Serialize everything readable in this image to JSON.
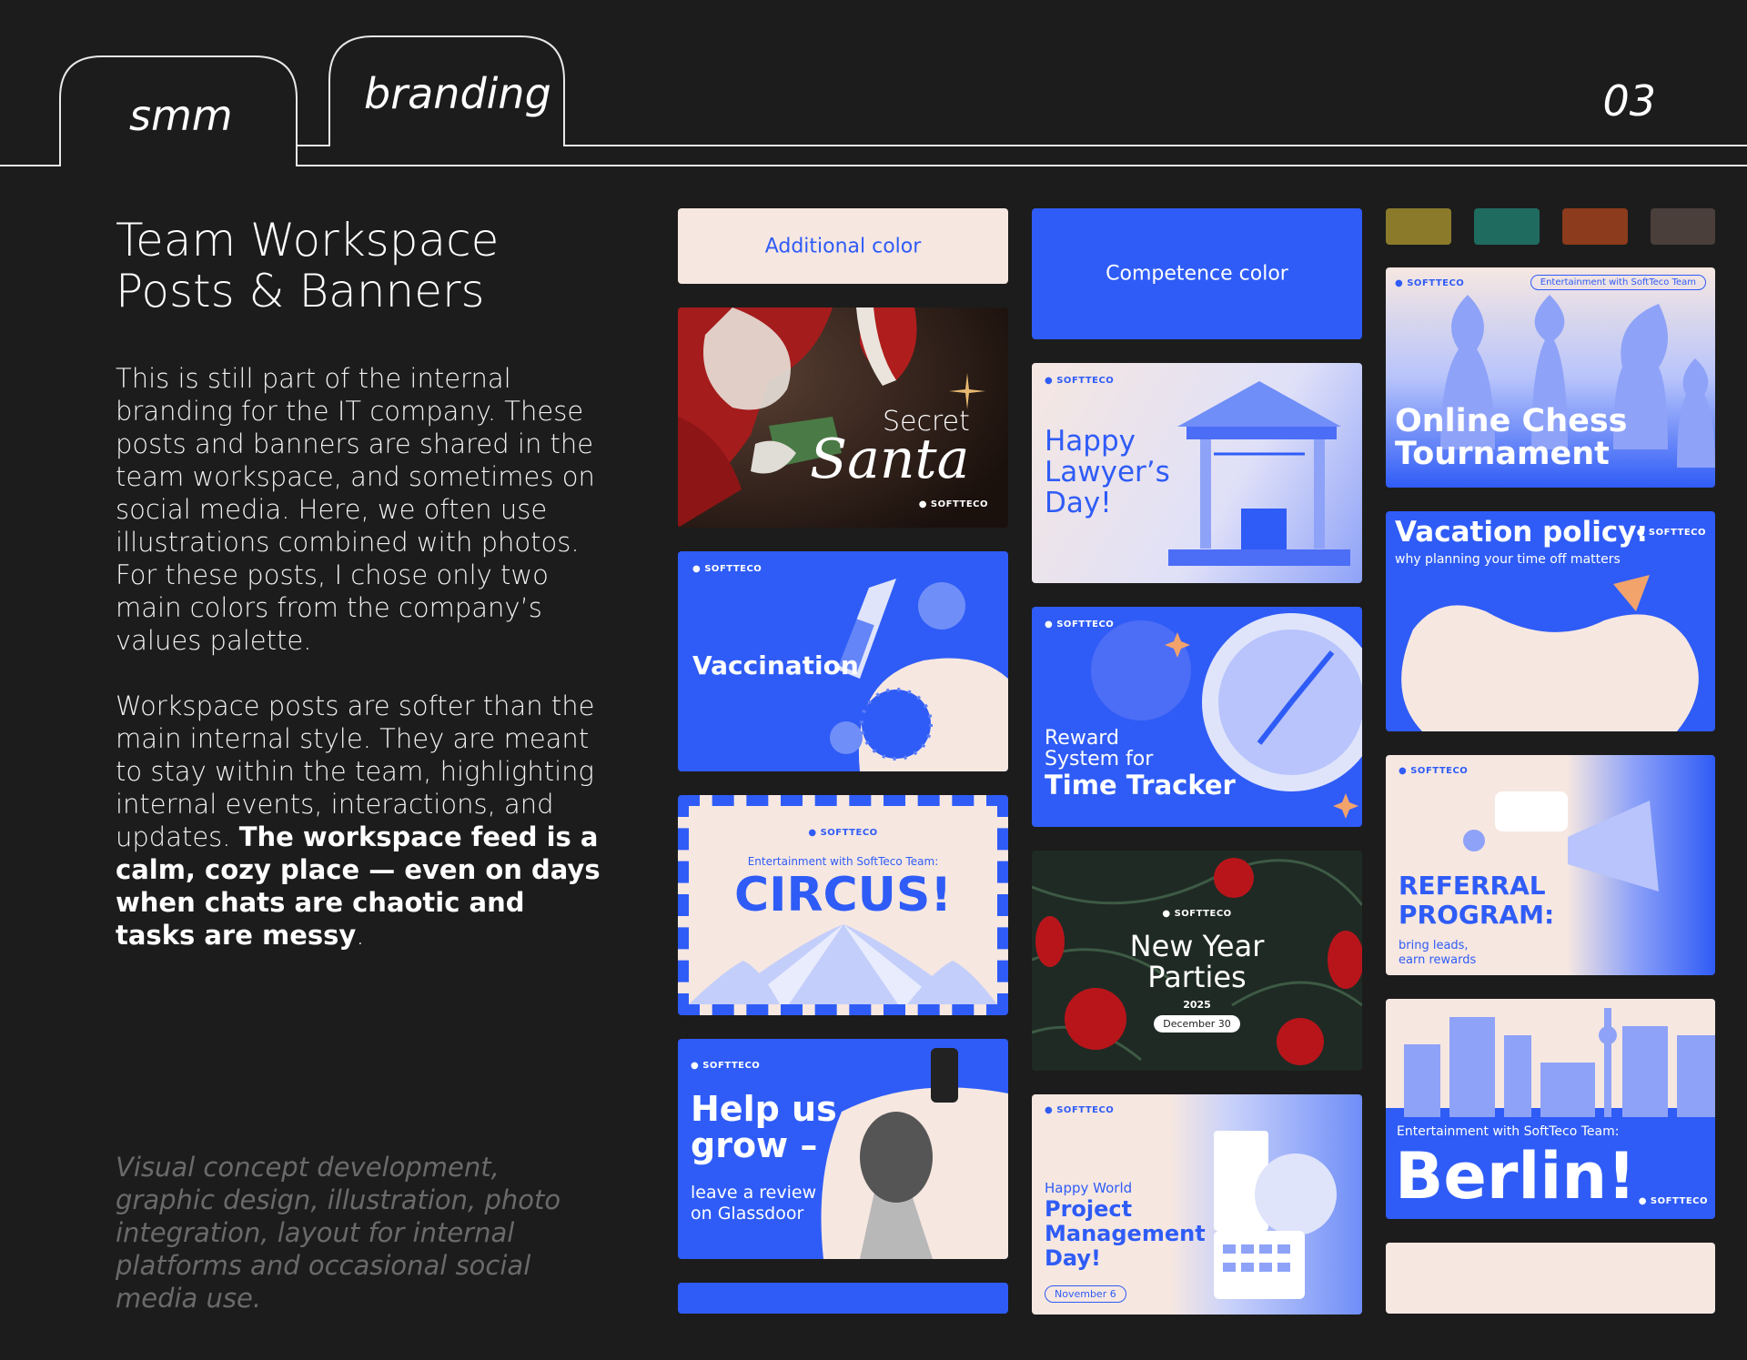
{
  "tabs": [
    {
      "label": "smm"
    },
    {
      "label": "branding"
    }
  ],
  "page_number": "03",
  "title_line1": "Team Workspace",
  "title_line2": "Posts & Banners",
  "paragraph1": "This is still part of the internal branding for the IT company. These posts and banners are shared in the team workspace, and sometimes on social media. Here, we often use illustrations combined with photos. For these posts, I chose only two main colors from the company’s values palette.",
  "paragraph2_normal": "Workspace posts are softer than the main internal style. They are meant to stay within the team, highlighting internal events, interactions, and updates. ",
  "paragraph2_bold": "The workspace feed is a calm, cozy place — even on days when chats are chaotic and tasks are messy",
  "paragraph2_end": ".",
  "credits": "Visual concept development, graphic design, illustration, photo integration, layout for internal platforms and occasional social media use.",
  "colors": {
    "additional": "#f6e7e1",
    "competence": "#2f5cf6",
    "palette": [
      "#8a7a2a",
      "#1f6b60",
      "#8c3b1c",
      "#4a3f3b"
    ]
  },
  "swatches": {
    "additional": "Additional color",
    "competence": "Competence color"
  },
  "brand": "SOFTTECO",
  "cards": {
    "santa": {
      "line1": "Secret",
      "line2": "Santa"
    },
    "vaccination": {
      "title": "Vaccination"
    },
    "circus": {
      "subtitle": "Entertainment with SoftTeco Team:",
      "title": "CIRCUS!"
    },
    "glassdoor": {
      "title1": "Help us",
      "title2": "grow –",
      "sub1": "leave a review",
      "sub2": "on Glassdoor"
    },
    "lawyer": {
      "l1": "Happy",
      "l2": "Lawyer’s",
      "l3": "Day!"
    },
    "reward": {
      "l1": "Reward",
      "l2": "System for",
      "l3": "Time Tracker"
    },
    "newyear": {
      "l1": "New Year",
      "l2": "Parties",
      "year": "2025",
      "date": "December 30"
    },
    "pm": {
      "l0": "Happy World",
      "l1": "Project",
      "l2": "Management",
      "l3": "Day!",
      "date": "November 6"
    },
    "chess": {
      "badge": "Entertainment with SoftTeco Team",
      "l1": "Online Chess",
      "l2": "Tournament"
    },
    "vacation": {
      "title": "Vacation policy:",
      "sub": "why planning your time off matters"
    },
    "referral": {
      "l1": "REFERRAL",
      "l2": "PROGRAM:",
      "s1": "bring leads,",
      "s2": "earn rewards"
    },
    "berlin": {
      "sub": "Entertainment with SoftTeco Team:",
      "title": "Berlin!"
    }
  }
}
